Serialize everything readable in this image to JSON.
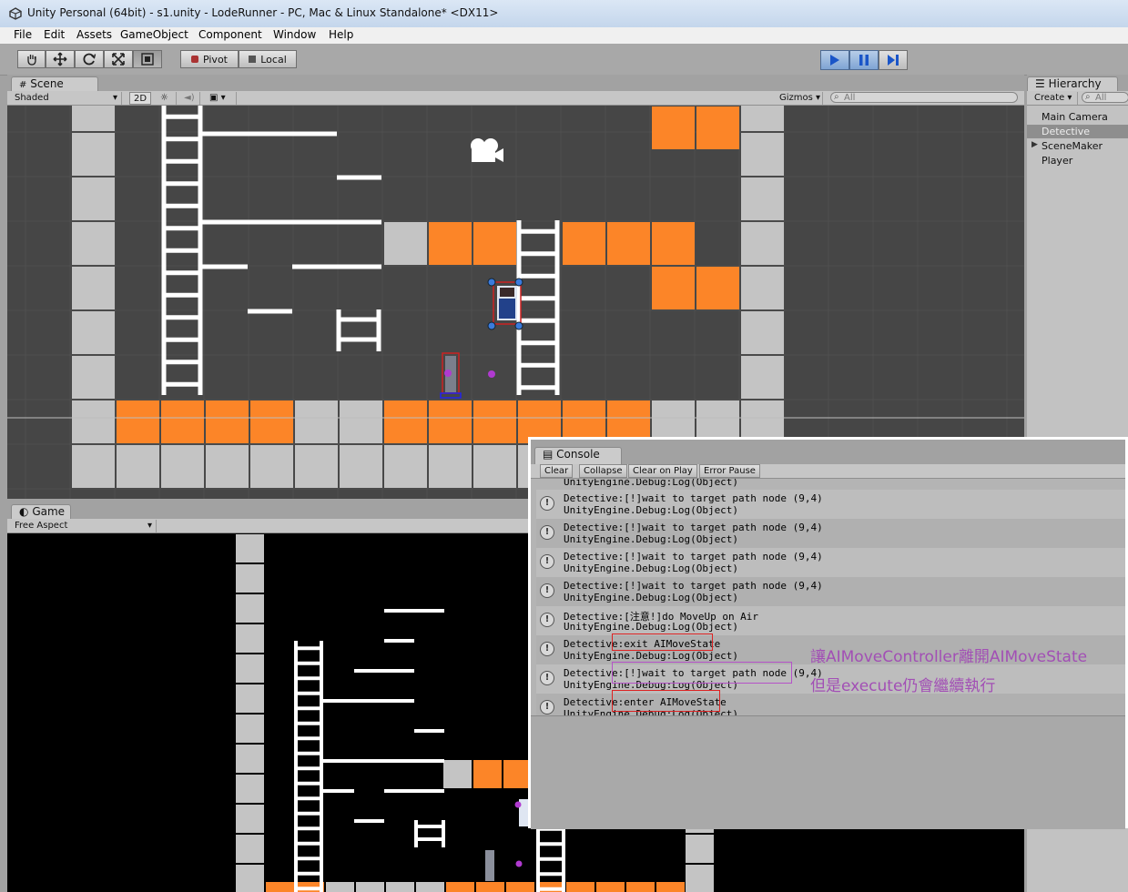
{
  "window": {
    "title": "Unity Personal (64bit) - s1.unity - LodeRunner - PC, Mac & Linux Standalone* <DX11>"
  },
  "menu": [
    "File",
    "Edit",
    "Assets",
    "GameObject",
    "Component",
    "Window",
    "Help"
  ],
  "toolbar": {
    "pivot": "Pivot",
    "local": "Local",
    "transform_tools": [
      "hand-icon",
      "move-icon",
      "rotate-icon",
      "scale-icon",
      "rect-icon"
    ]
  },
  "scene_panel": {
    "tab": "Scene",
    "shading": "Shaded",
    "mode_2d": "2D",
    "gizmos": "Gizmos",
    "search_placeholder": "All"
  },
  "game_panel": {
    "tab": "Game",
    "aspect": "Free Aspect"
  },
  "hierarchy": {
    "tab": "Hierarchy",
    "create": "Create",
    "search_placeholder": "All",
    "items": [
      "Main Camera",
      "Detective",
      "SceneMaker",
      "Player"
    ],
    "selected": "Detective"
  },
  "console": {
    "tab": "Console",
    "buttons": [
      "Clear",
      "Collapse",
      "Clear on Play",
      "Error Pause"
    ],
    "top_partial": "UnityEngine.Debug:Log(Object)",
    "entries": [
      {
        "line1": "Detective:[!]wait to target path node (9,4)",
        "line2": "UnityEngine.Debug:Log(Object)"
      },
      {
        "line1": "Detective:[!]wait to target path node (9,4)",
        "line2": "UnityEngine.Debug:Log(Object)"
      },
      {
        "line1": "Detective:[!]wait to target path node (9,4)",
        "line2": "UnityEngine.Debug:Log(Object)"
      },
      {
        "line1": "Detective:[!]wait to target path node (9,4)",
        "line2": "UnityEngine.Debug:Log(Object)"
      },
      {
        "line1": "Detective:[注意!]do MoveUp on Air",
        "line2": "UnityEngine.Debug:Log(Object)"
      },
      {
        "line1": "Detective:exit AIMoveState",
        "line2": "UnityEngine.Debug:Log(Object)"
      },
      {
        "line1": "Detective:[!]wait to target path node (9,4)",
        "line2": "UnityEngine.Debug:Log(Object)"
      },
      {
        "line1": "Detective:enter AIMoveState",
        "line2": "UnityEngine.Debug:Log(Object)"
      }
    ]
  },
  "annotation": {
    "line1": "讓AIMoveController離開AIMoveState",
    "line2": "但是execute仍會繼續執行"
  },
  "colors": {
    "orange": "#fc8528",
    "grey_block": "#c4c4c4",
    "scene_bg": "#464646",
    "note": "#a24fb5"
  }
}
